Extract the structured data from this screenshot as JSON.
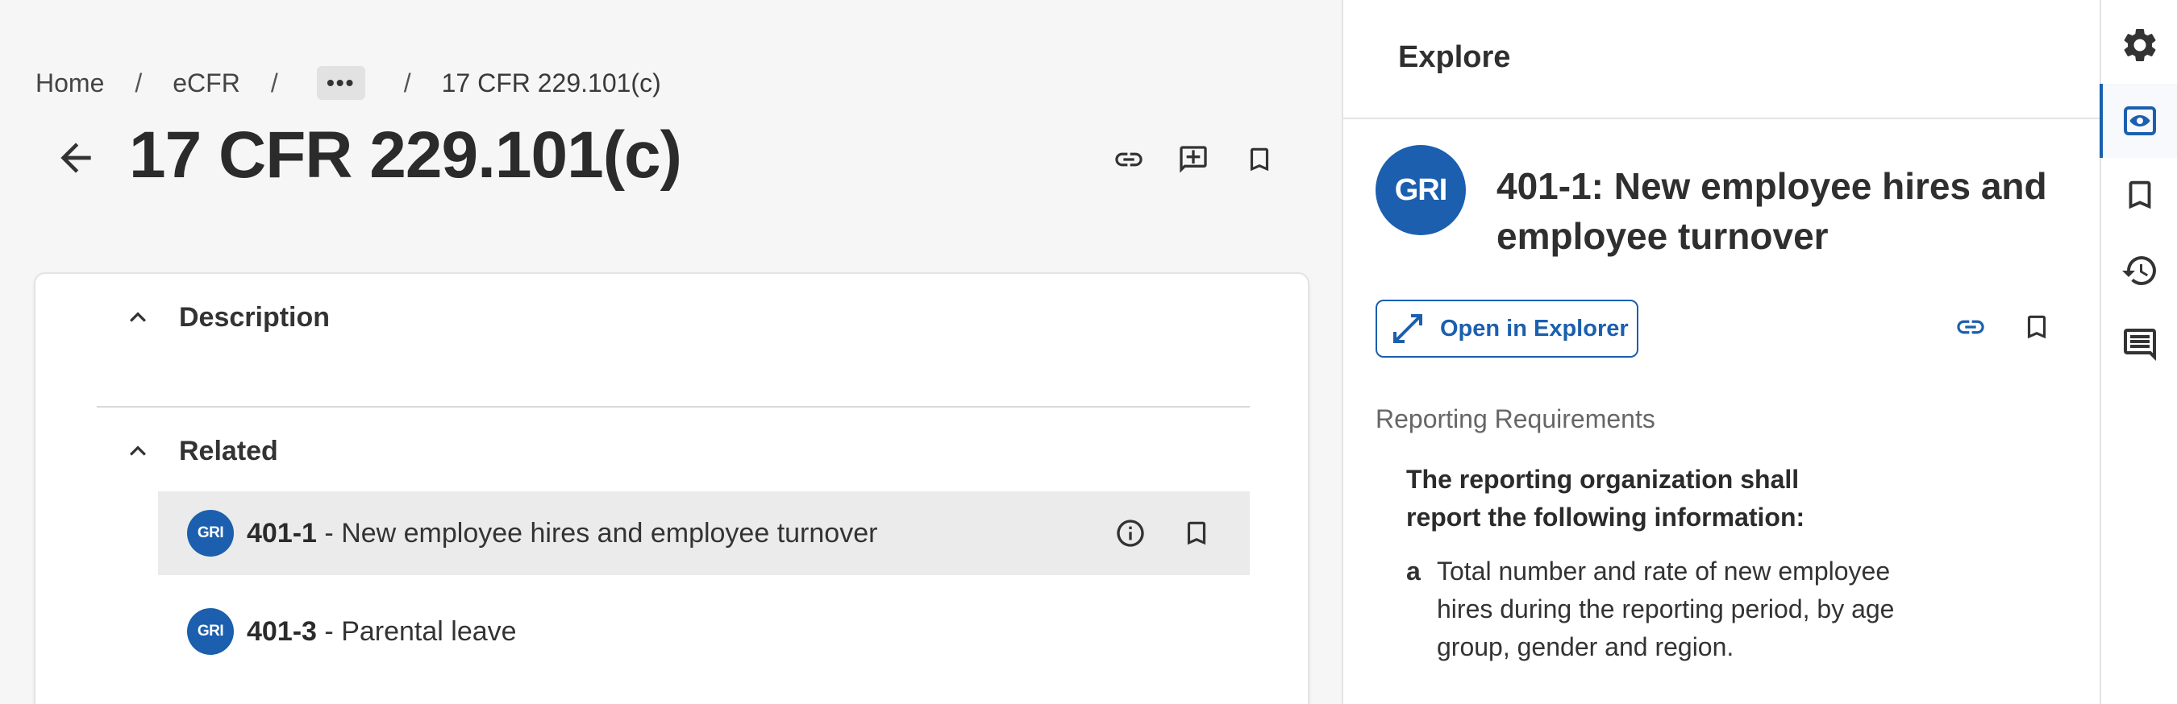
{
  "breadcrumb": {
    "home": "Home",
    "ecfr": "eCFR",
    "more": "•••",
    "current": "17 CFR 229.101(c)",
    "separator": "/"
  },
  "page": {
    "title": "17 CFR 229.101(c)"
  },
  "sections": {
    "description_label": "Description",
    "related_label": "Related"
  },
  "related_items": [
    {
      "badge": "GRI",
      "code": "401-1",
      "separator": " - ",
      "name": "New employee hires and employee turnover"
    },
    {
      "badge": "GRI",
      "code": "401-3",
      "separator": " - ",
      "name": "Parental leave"
    }
  ],
  "explore": {
    "panel_title": "Explore",
    "badge": "GRI",
    "detail_title": "401-1: New employee hires and employee turnover",
    "open_button_label": "Open in Explorer",
    "requirements_heading": "Reporting Requirements",
    "requirements_lead": "The reporting organization shall report the following information:",
    "item_letter": "a",
    "item_text": "Total number and rate of new employee hires during the reporting period, by age group, gender and region."
  },
  "icons": {
    "back": "arrow-left-icon",
    "link": "link-icon",
    "add_note": "add-comment-icon",
    "bookmark": "bookmark-icon",
    "info": "info-icon",
    "expand": "expand-icon",
    "settings": "gear-icon",
    "explore": "eye-icon",
    "history": "history-icon",
    "comments": "comment-icon",
    "chevron": "chevron-up-icon"
  },
  "colors": {
    "accent": "#1b5fae",
    "left_background": "#f6f6f6",
    "row_highlight": "#ebebeb"
  }
}
